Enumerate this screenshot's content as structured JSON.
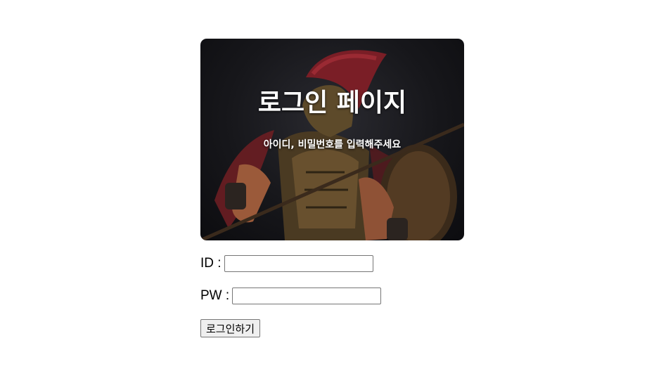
{
  "hero": {
    "title": "로그인 페이지",
    "subtitle": "아이디, 비밀번호를 입력해주세요",
    "image": "spartan-warrior-image"
  },
  "form": {
    "id_label": "ID :",
    "id_value": "",
    "pw_label": "PW :",
    "pw_value": "",
    "submit_label": "로그인하기"
  },
  "colors": {
    "hero_text": "#ffffff",
    "button_bg": "#efefef",
    "input_border": "#767676"
  }
}
